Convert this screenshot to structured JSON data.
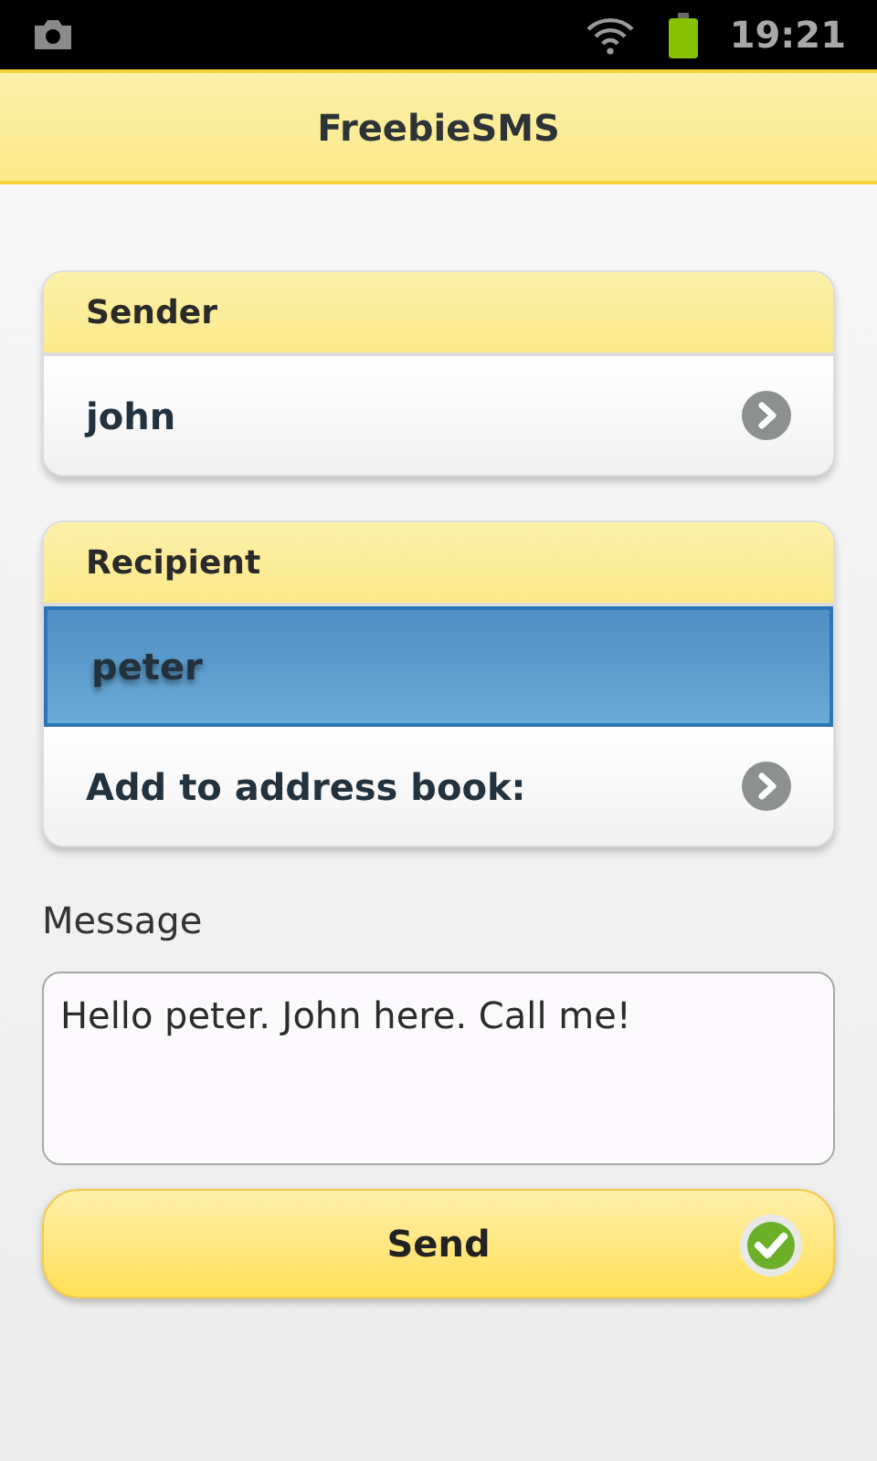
{
  "status_bar": {
    "time": "19:21"
  },
  "title": "FreebieSMS",
  "groups": [
    {
      "header": "Sender",
      "items": [
        {
          "label": "john",
          "kind": "link",
          "selected": false
        }
      ]
    },
    {
      "header": "Recipient",
      "items": [
        {
          "label": "peter",
          "kind": "plain",
          "selected": true
        },
        {
          "label": "Add to address book:",
          "kind": "link",
          "selected": false
        }
      ]
    }
  ],
  "message": {
    "label": "Message",
    "value": "Hello peter. John here. Call me!"
  },
  "send_button": {
    "label": "Send"
  }
}
